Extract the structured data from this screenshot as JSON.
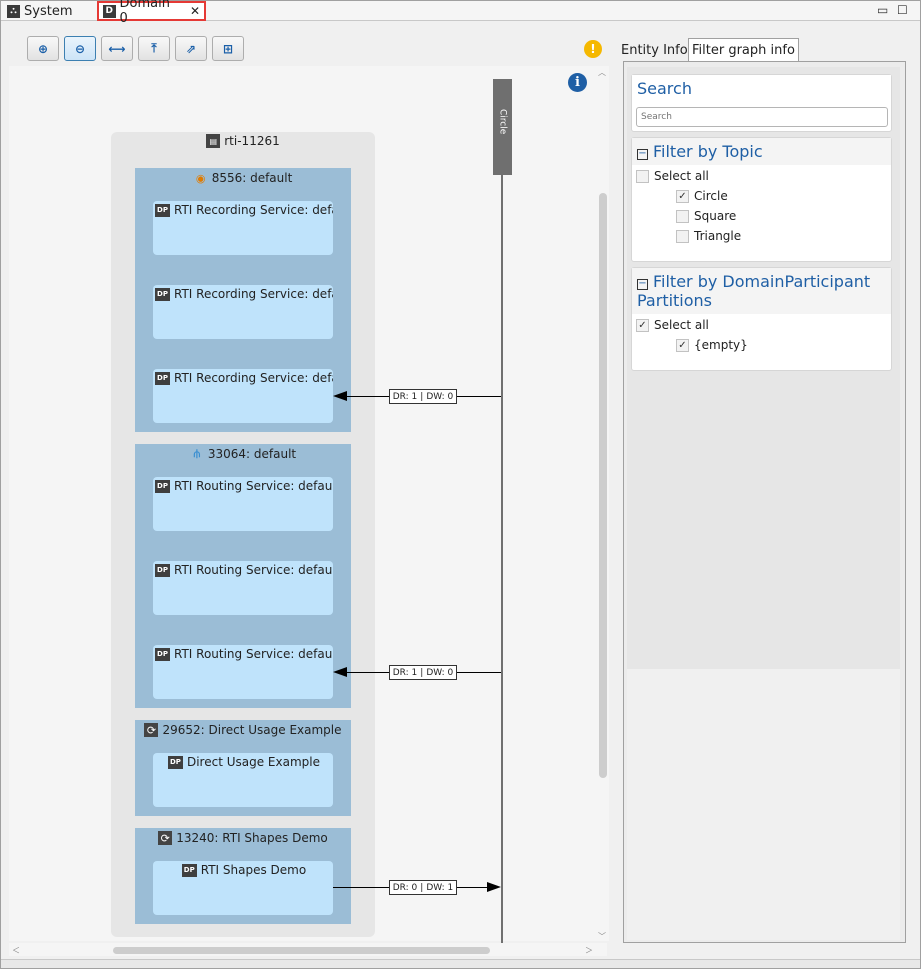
{
  "tabs": [
    {
      "label": "System",
      "icon": "network-icon"
    },
    {
      "label": "Domain 0",
      "icon": "domain-icon",
      "close": "✕"
    }
  ],
  "window_controls": {
    "minimize": "▭",
    "maximize": "☐"
  },
  "toolbar": {
    "buttons": [
      {
        "name": "zoom-in-button",
        "icon": "zoom-in-icon",
        "glyph": "⊕"
      },
      {
        "name": "zoom-out-button",
        "icon": "zoom-out-icon",
        "glyph": "⊖"
      },
      {
        "name": "fit-width-button",
        "icon": "fit-width-icon",
        "glyph": "⟷"
      },
      {
        "name": "align-top-button",
        "icon": "align-top-icon",
        "glyph": "⤒"
      },
      {
        "name": "export-button",
        "icon": "export-icon",
        "glyph": "⇗"
      },
      {
        "name": "layout-button",
        "icon": "layout-icon",
        "glyph": "⊞"
      }
    ]
  },
  "graph": {
    "info_glyph": "i",
    "topic": "Circle",
    "host": {
      "label": "rti-11261",
      "icon": "host-icon"
    },
    "processes": [
      {
        "label": "8556: default",
        "icon": "recording-icon",
        "participants": [
          "RTI Recording Service: default",
          "RTI Recording Service: default",
          "RTI Recording Service: defa..."
        ]
      },
      {
        "label": "33064: default",
        "icon": "routing-icon",
        "participants": [
          "RTI Routing Service: default",
          "RTI Routing Service: default",
          "RTI Routing Service: default...."
        ]
      },
      {
        "label": "29652: Direct Usage Example",
        "icon": "sync-icon",
        "participants": [
          "Direct Usage Example"
        ]
      },
      {
        "label": "13240: RTI Shapes Demo",
        "icon": "sync-icon",
        "participants": [
          "RTI Shapes Demo"
        ]
      }
    ],
    "dp_badge": "DP",
    "connections": [
      {
        "dr": "DR: 1",
        "dw": "DW: 0",
        "direction": "to-participant"
      },
      {
        "dr": "DR: 1",
        "dw": "DW: 0",
        "direction": "to-participant"
      },
      {
        "dr": "DR: 0",
        "dw": "DW: 1",
        "direction": "to-topic"
      }
    ],
    "separator": "|"
  },
  "right_panel": {
    "warning_glyph": "!",
    "tabs": [
      "Entity Info",
      "Filter graph info"
    ],
    "selected_tab": "Filter graph info",
    "search": {
      "title": "Search",
      "placeholder": "Search"
    },
    "filter_topic": {
      "title": "Filter by Topic",
      "select_all": "Select all",
      "items": [
        {
          "label": "Circle",
          "checked": true
        },
        {
          "label": "Square",
          "checked": false
        },
        {
          "label": "Triangle",
          "checked": false
        }
      ]
    },
    "filter_partitions": {
      "title_line1": "Filter by DomainParticipant",
      "title_line2": "Partitions",
      "select_all": "Select all",
      "select_all_checked": true,
      "items": [
        {
          "label": "{empty}",
          "checked": true
        }
      ]
    },
    "collapse_glyph": "−",
    "check_glyph": "✓"
  },
  "colors": {
    "accent": "#1f5fa5",
    "process_bg": "#9bbdd6",
    "participant_bg": "#bfe3fb",
    "highlight": "#e53935"
  }
}
